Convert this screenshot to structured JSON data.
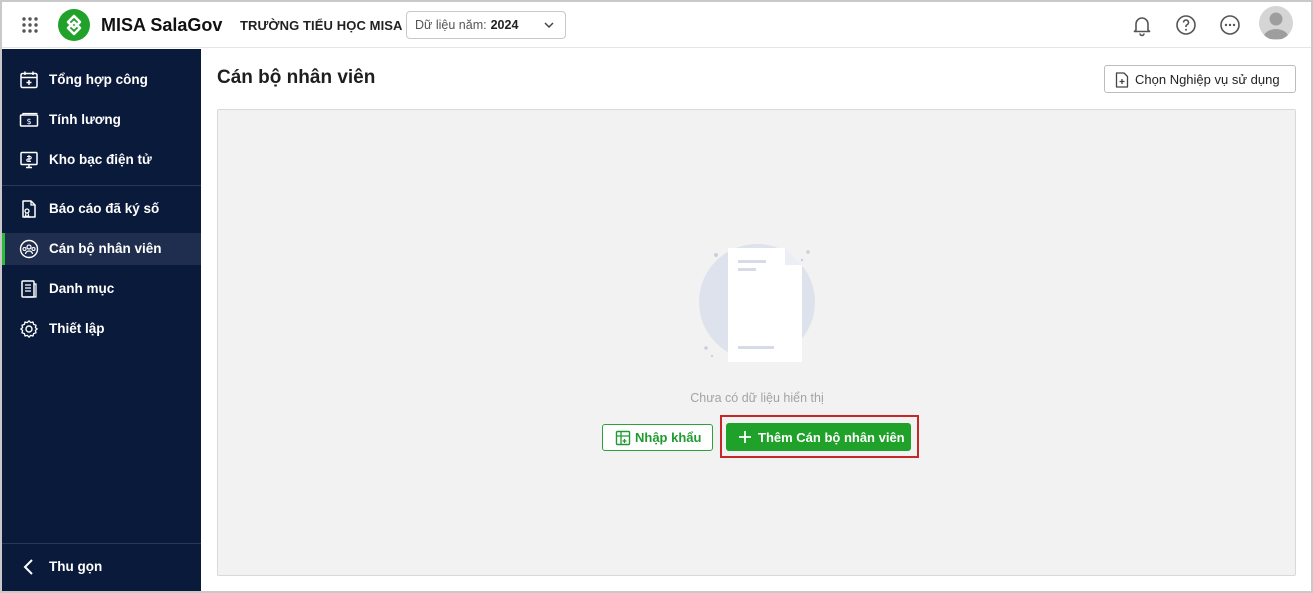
{
  "header": {
    "app_name": "MISA SalaGov",
    "school_name": "TRƯỜNG TIỂU HỌC MISA",
    "year_select": {
      "label": "Dữ liệu năm:",
      "value": "2024"
    },
    "icons": [
      "apps-grid-icon",
      "bell-icon",
      "help-icon",
      "more-icon",
      "user-avatar"
    ]
  },
  "sidebar": {
    "items": [
      {
        "label": "Tổng hợp công",
        "icon": "calendar-icon",
        "active": false
      },
      {
        "label": "Tính lương",
        "icon": "money-icon",
        "active": false
      },
      {
        "label": "Kho bạc điện tử",
        "icon": "treasury-icon",
        "active": false
      },
      {
        "label": "Báo cáo đã ký số",
        "icon": "signed-report-icon",
        "active": false
      },
      {
        "label": "Cán bộ nhân viên",
        "icon": "staff-icon",
        "active": true
      },
      {
        "label": "Danh mục",
        "icon": "catalog-icon",
        "active": false
      },
      {
        "label": "Thiết lập",
        "icon": "settings-icon",
        "active": false
      }
    ],
    "collapse_label": "Thu gọn"
  },
  "main": {
    "title": "Cán bộ nhân viên",
    "choose_button": "Chọn Nghiệp vụ sử dụng",
    "empty_text": "Chưa có dữ liệu hiển thị",
    "import_button": "Nhập khẩu",
    "add_button": "Thêm Cán bộ nhân viên"
  },
  "colors": {
    "sidebar_bg": "#0a1a3a",
    "accent_green": "#1fa12a",
    "highlight_red": "#c62828"
  }
}
